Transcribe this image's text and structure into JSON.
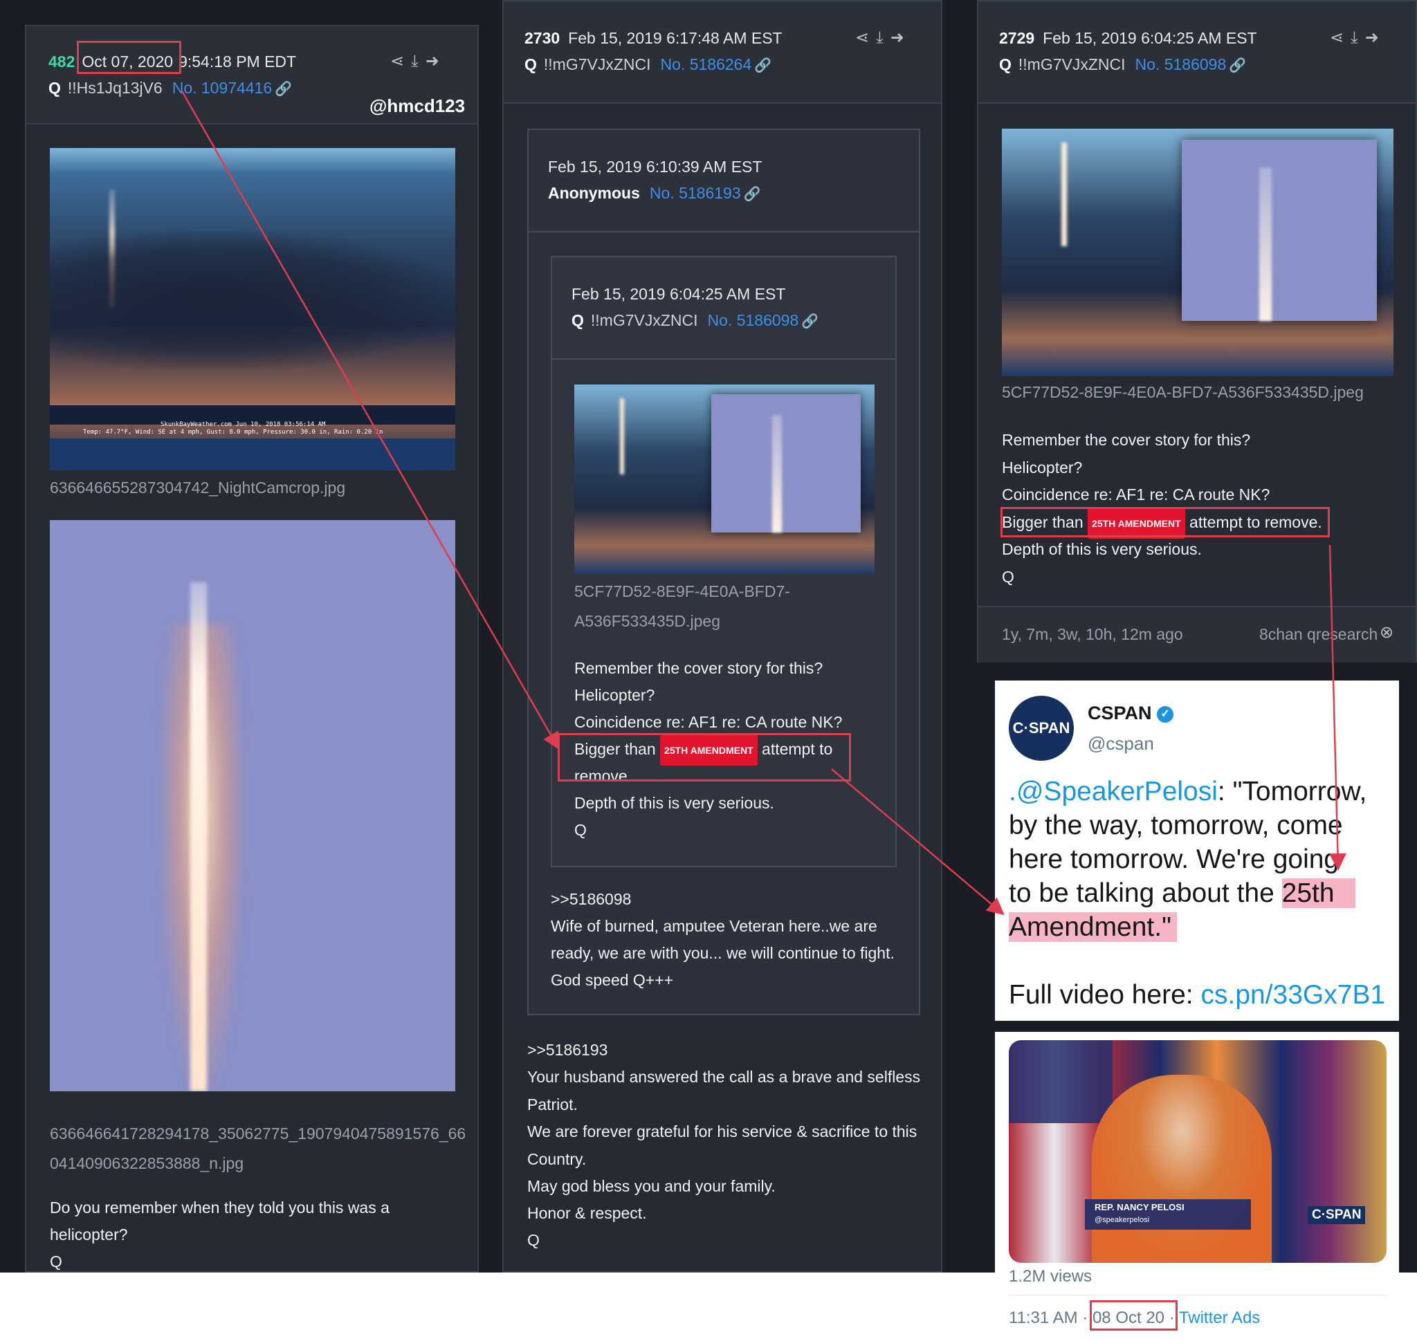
{
  "left_post": {
    "num": "482",
    "date": "Oct 07, 2020",
    "time": "9:54:18 PM EDT",
    "q": "Q",
    "trip": "!!Hs1Jq13jV6",
    "post_no": "No. 10974416",
    "watermark": "@hmcd123",
    "file1": "636646655287304742_NightCamcrop.jpg",
    "file2_line1": "636646641728294178_35062775_1907940475891576_66",
    "file2_line2": "04140906322853888_n.jpg",
    "body_line1": "Do you remember when they told you this was a",
    "body_line2": "helicopter?",
    "sig": "Q",
    "weather_line1": "SkunkBayWeather.com  Jun 10, 2018  03:56:14 AM",
    "weather_line2": "Temp:  47.7°F, Wind: SE  at   4 mph, Gust:  8.0 mph, Pressure:  30.0 in, Rain: 0.20 in"
  },
  "mid_post": {
    "num": "2730",
    "datetime": "Feb 15, 2019 6:17:48 AM EST",
    "q": "Q",
    "trip": "!!mG7VJxZNCI",
    "post_no": "No. 5186264",
    "quoted1": {
      "datetime": "Feb 15, 2019 6:10:39 AM EST",
      "author": "Anonymous",
      "post_no": "No. 5186193"
    },
    "quoted2": {
      "datetime": "Feb 15, 2019 6:04:25 AM EST",
      "q": "Q",
      "trip": "!!mG7VJxZNCI",
      "post_no": "No. 5186098",
      "file_line1": "5CF77D52-8E9F-4E0A-BFD7-",
      "file_line2": "A536F533435D.jpeg",
      "l1": "Remember the cover story for this?",
      "l2": "Helicopter?",
      "l3": "Coincidence re: AF1 re: CA route NK?",
      "l4a": "Bigger than",
      "tag": "25TH AMENDMENT",
      "l4b": "attempt to",
      "l4c": "remove.",
      "l5": "Depth of this is very serious.",
      "sig": "Q"
    },
    "anon_reply": {
      "ref": ">>5186098",
      "l1": "Wife of burned, amputee Veteran here..we are",
      "l2": "ready, we are with you... we will continue to fight.",
      "l3": "God speed Q+++"
    },
    "q_reply": {
      "ref": ">>5186193",
      "l1": "Your husband answered the call as a brave and selfless",
      "l2": "Patriot.",
      "l3": "We are forever grateful for his service & sacrifice to this",
      "l4": "Country.",
      "l5": "May god bless you and your family.",
      "l6": "Honor & respect.",
      "sig": "Q"
    }
  },
  "right_post": {
    "num": "2729",
    "datetime": "Feb 15, 2019 6:04:25 AM EST",
    "q": "Q",
    "trip": "!!mG7VJxZNCI",
    "post_no": "No. 5186098",
    "file": "5CF77D52-8E9F-4E0A-BFD7-A536F533435D.jpeg",
    "l1": "Remember the cover story for this?",
    "l2": "Helicopter?",
    "l3": "Coincidence re: AF1 re: CA route NK?",
    "l4a": "Bigger than",
    "tag": "25TH AMENDMENT",
    "l4b": "attempt to remove.",
    "l5": "Depth of this is very serious.",
    "sig": "Q",
    "ago": "1y, 7m, 3w, 10h, 12m ago",
    "source": "8chan qresearch"
  },
  "tweet": {
    "logo": "C·SPAN",
    "name": "CSPAN",
    "handle": "@cspan",
    "mention": ".@SpeakerPelosi",
    "t1": ": \"Tomorrow,",
    "t2": "by the way, tomorrow, come",
    "t3": "here tomorrow. We're going",
    "t4": "to be talking about the ",
    "t4hl": "25th",
    "t5hl": "Amendment.\"",
    "full": "Full video here: ",
    "link": "cs.pn/33Gx7B1",
    "lower_third_name": "REP. NANCY PELOSI",
    "lower_third_handle": "@speakerpelosi",
    "bug": "C·SPAN",
    "views": "1.2M views",
    "time": "11:31 AM · ",
    "date": "08 Oct 20",
    "sep": " · ",
    "via": "Twitter Ads"
  },
  "colors": {
    "panel": "#262a33",
    "link": "#3f8fe6",
    "highlight": "#e03c4f",
    "tag": "#e3152e",
    "twitter_blue": "#1b95e0",
    "cspan_navy": "#15305f"
  }
}
